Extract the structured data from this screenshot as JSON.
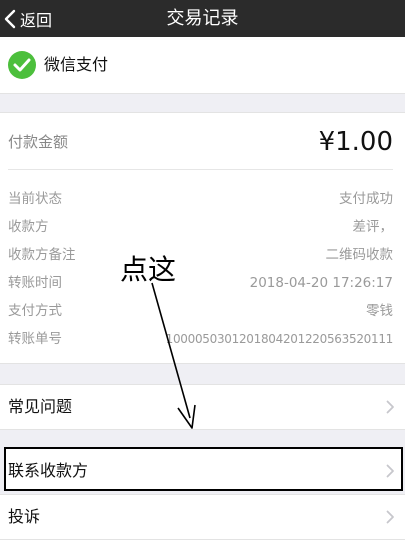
{
  "nav": {
    "back_label": "返回",
    "title": "交易记录"
  },
  "merchant": {
    "name": "微信支付"
  },
  "detail": {
    "amount_label": "付款金额",
    "amount_value": "¥1.00",
    "rows": [
      {
        "label": "当前状态",
        "value": "支付成功"
      },
      {
        "label": "收款方",
        "value": "差评，"
      },
      {
        "label": "收款方备注",
        "value": "二维码收款"
      },
      {
        "label": "转账时间",
        "value": "2018-04-20 17:26:17"
      },
      {
        "label": "支付方式",
        "value": "零钱"
      },
      {
        "label": "转账单号",
        "value": "1000050301201804201220563520111"
      }
    ]
  },
  "actions": {
    "faq": "常见问题",
    "contact": "联系收款方",
    "complaint": "投诉"
  },
  "annotation": {
    "text": "点这"
  },
  "colors": {
    "nav_bg": "#2b2b2b",
    "wechat_green": "#4cbf3c",
    "page_bg": "#efeff4"
  }
}
